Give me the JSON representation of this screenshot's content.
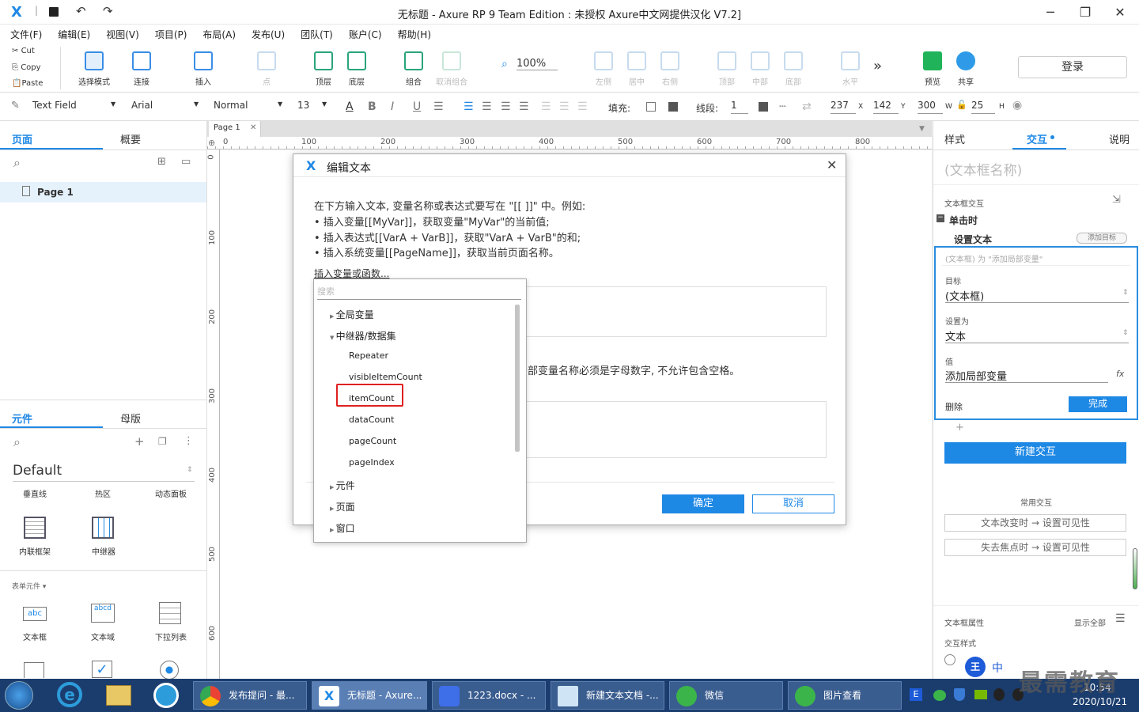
{
  "window": {
    "title": "无标题 - Axure RP 9 Team Edition : 未授权      Axure中文网提供汉化 V7.2]",
    "min": "─",
    "max": "❐",
    "close": "✕"
  },
  "menu": [
    "文件(F)",
    "编辑(E)",
    "视图(V)",
    "项目(P)",
    "布局(A)",
    "发布(U)",
    "团队(T)",
    "账户(C)",
    "帮助(H)"
  ],
  "clipboard": {
    "cut": "Cut",
    "copy": "Copy",
    "paste": "Paste"
  },
  "toolbar": {
    "select": "选择模式",
    "connect": "连接",
    "insert": "插入",
    "point": "点",
    "top": "顶层",
    "bottom": "底层",
    "group": "组合",
    "ungroup": "取消组合",
    "zoom": "100%",
    "left": "左侧",
    "center": "居中",
    "right": "右侧",
    "vtop": "顶部",
    "middle": "中部",
    "vbottom": "底部",
    "horizontal": "水平",
    "more": "»",
    "preview": "预览",
    "share": "共享",
    "login": "登录"
  },
  "format": {
    "widget": "Text Field",
    "font": "Arial",
    "style": "Normal",
    "size": "13",
    "fill": "填充:",
    "line": "线段:",
    "line_val": "1",
    "x": "237",
    "x_lbl": "X",
    "y": "142",
    "y_lbl": "Y",
    "w": "300",
    "w_lbl": "W",
    "h": "25",
    "h_lbl": "H",
    "bold": "B",
    "italic": "I",
    "underline": "U",
    "color": "A"
  },
  "pages": {
    "tab1": "页面",
    "tab2": "概要",
    "page1": "Page 1"
  },
  "widgets": {
    "tab1": "元件",
    "tab2": "母版",
    "library": "Default",
    "items": [
      "垂直线",
      "热区",
      "动态面板",
      "内联框架",
      "中继器"
    ],
    "form_section": "表单元件 ▾",
    "form_items": [
      "文本框",
      "文本域",
      "下拉列表"
    ]
  },
  "canvas": {
    "tab": "Page 1",
    "ruler_h": [
      "0",
      "100",
      "200",
      "300",
      "400",
      "500",
      "600",
      "700",
      "800"
    ],
    "ruler_v": [
      "0",
      "100",
      "200",
      "300",
      "400",
      "500",
      "600"
    ]
  },
  "dialog": {
    "title": "编辑文本",
    "intro": "在下方输入文本, 变量名称或表达式要写在 \"[[ ]]\" 中。例如:",
    "b1": "• 插入变量[[MyVar]]，获取变量\"MyVar\"的当前值;",
    "b2": "• 插入表达式[[VarA + VarB]]，获取\"VarA + VarB\"的和;",
    "b3": "• 插入系统变量[[PageName]]，获取当前页面名称。",
    "insert_link": "插入变量或函数...",
    "local_note": "部变量名称必须是字母数字, 不允许包含空格。",
    "ok": "确定",
    "cancel": "取消"
  },
  "dropdown": {
    "search": "搜索",
    "global": "全局变量",
    "repeater_group": "中继器/数据集",
    "items": [
      "Repeater",
      "visibleItemCount",
      "itemCount",
      "dataCount",
      "pageCount",
      "pageIndex"
    ],
    "widget": "元件",
    "page": "页面",
    "window": "窗口"
  },
  "right": {
    "tab1": "样式",
    "tab2": "交互",
    "tab3": "说明",
    "name": "(文本框名称)",
    "section": "文本框交互",
    "event": "单击时",
    "action": "设置文本",
    "add_target": "添加目标",
    "summary": "(文本框) 为 \"添加局部变量\"",
    "target_lbl": "目标",
    "target_val": "(文本框)",
    "set_lbl": "设置为",
    "set_val": "文本",
    "value_lbl": "值",
    "value_val": "添加局部变量",
    "fx": "fx",
    "delete": "删除",
    "done": "完成",
    "plus": "+",
    "new_interaction": "新建交互",
    "common": "常用交互",
    "c1": "文本改变时 → 设置可见性",
    "c2": "失去焦点时 → 设置可见性",
    "props": "文本框属性",
    "show_all": "显示全部",
    "istyle": "交互样式"
  },
  "taskbar": {
    "t1": "发布提问 - 最...",
    "t2": "无标题 - Axure...",
    "t3": "1223.docx - ...",
    "t4": "新建文本文档 -...",
    "t5": "微信",
    "t6": "图片查看",
    "time": "10:54",
    "date": "2020/10/21",
    "ime": "中",
    "watermark": "最需教育"
  },
  "colors": {
    "accent": "#1e88e5",
    "highlight": "#e02020"
  }
}
